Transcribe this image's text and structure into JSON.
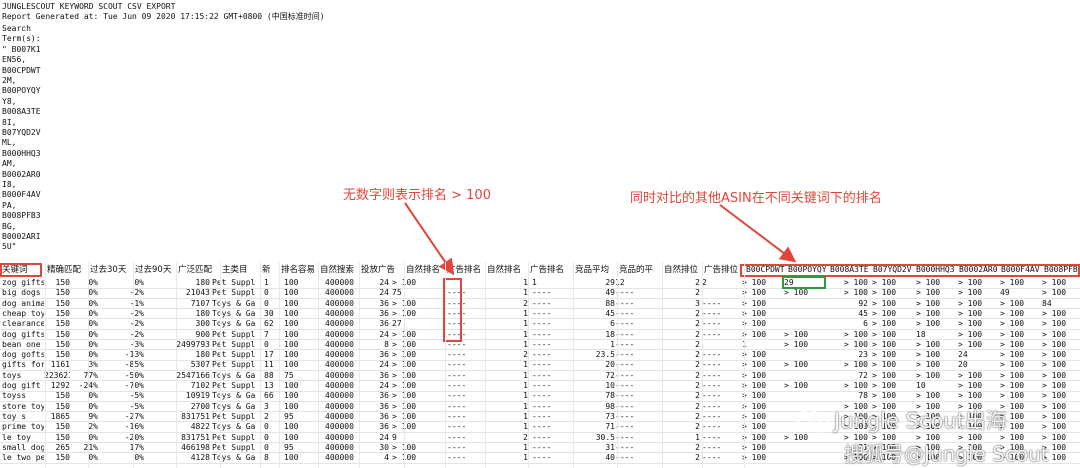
{
  "report": {
    "title": "JUNGLESCOUT KEYWORD SCOUT CSV EXPORT",
    "generated": "Report Generated at: Tue Jun 09 2020 17:15:22 GMT+0800 (中国标准时间)",
    "search_lines": [
      "Search",
      "Term(s):",
      "\" B007K1",
      "EN56,",
      "B00CPDWT",
      "2M,",
      "B00POYQY",
      "Y8,",
      "B008A3TE",
      "8I,",
      "B07YQD2V",
      "ML,",
      "B000HHQ3",
      "AM,",
      "B0002AR0",
      "I8,",
      "B000F4AV",
      "PA,",
      "B008PFB3",
      "BG,",
      "B0002ARI",
      "5U\""
    ]
  },
  "table": {
    "headers": [
      "关键词",
      "精确匹配",
      "过去30天",
      "过去90天",
      "广泛匹配",
      "主类目",
      "新",
      "排名容易",
      "自然搜索",
      "投放广告",
      "自然排名",
      "广告排名",
      "自然排名",
      "广告排名",
      "竞品平均",
      "竞品的平",
      "自然排位",
      "广告排位",
      "B00CPDWT",
      "B00POYQY",
      "B008A3TE",
      "B07YQD2V",
      "B000HHQ3",
      "B0002AR0",
      "B000F4AV",
      "B008PFB3"
    ],
    "rows": [
      [
        "zog gifts",
        "150",
        "0%",
        "0%",
        "180",
        "Pet Suppl",
        "1",
        "100",
        "400000",
        "24",
        "> 100",
        "",
        "",
        "1",
        "1",
        "29",
        "12",
        "2",
        "2",
        "> 100",
        "29",
        "> 100",
        "> 100",
        "> 100",
        "> 100",
        "> 100",
        "> 100"
      ],
      [
        "big dogs",
        "150",
        "0%",
        "-2%",
        "21043",
        "Pet Suppl",
        "0",
        "100",
        "400000",
        "24",
        "75",
        "----",
        "",
        "1",
        "----",
        "49",
        "----",
        "2",
        "",
        "> 100",
        "> 100",
        "> 100",
        "> 100",
        "> 100",
        "> 100",
        "49",
        "> 100"
      ],
      [
        "dog anima",
        "150",
        "0%",
        "-1%",
        "7107",
        "Toys & Ga",
        "0",
        "100",
        "400000",
        "36",
        "> 100",
        "----",
        "",
        "2",
        "----",
        "88",
        "----",
        "3",
        "----",
        "> 100",
        "",
        "92",
        "> 100",
        "> 100",
        "> 100",
        "> 100",
        "84"
      ],
      [
        "cheap toy",
        "150",
        "0%",
        "-2%",
        "180",
        "Toys & Ga",
        "30",
        "100",
        "400000",
        "36",
        "> 100",
        "----",
        "",
        "1",
        "----",
        "45",
        "----",
        "2",
        "----",
        "> 100",
        "",
        "45",
        "> 100",
        "> 100",
        "> 100",
        "> 100",
        "> 100"
      ],
      [
        "clearance",
        "150",
        "0%",
        "-2%",
        "300",
        "Toys & Ga",
        "62",
        "100",
        "400000",
        "36",
        "27",
        "----",
        "",
        "1",
        "----",
        "6",
        "----",
        "2",
        "----",
        "> 100",
        "",
        "6",
        "> 100",
        "> 100",
        "> 100",
        "> 100",
        "> 100"
      ],
      [
        "dog gifts",
        "150",
        "0%",
        "-2%",
        "900",
        "Pet Suppl",
        "7",
        "100",
        "400000",
        "24",
        "> 100",
        "----",
        "",
        "1",
        "----",
        "18",
        "----",
        "2",
        "----",
        "> 100",
        "> 100",
        "> 100",
        "> 100",
        "18",
        "> 100",
        "> 100",
        "> 100"
      ],
      [
        "bean one",
        "150",
        "0%",
        "-3%",
        "2499793",
        "Pet Suppl",
        "0",
        "100",
        "400000",
        "8",
        "> 100",
        "----",
        "",
        "1",
        "----",
        "1",
        "----",
        "2",
        "",
        "1",
        "> 100",
        "> 100",
        "> 100",
        "> 100",
        "> 100",
        "> 100",
        "> 100"
      ],
      [
        "dog gofts",
        "150",
        "0%",
        "-13%",
        "180",
        "Pet Suppl",
        "17",
        "100",
        "400000",
        "36",
        "> 100",
        "----",
        "",
        "2",
        "----",
        "23.5",
        "----",
        "2",
        "----",
        "> 100",
        "",
        "23",
        "> 100",
        "> 100",
        "24",
        "> 100",
        "> 100"
      ],
      [
        "gifts for",
        "1161",
        "3%",
        "-85%",
        "5307",
        "Pet Suppl",
        "11",
        "100",
        "400000",
        "24",
        "> 100",
        "----",
        "",
        "1",
        "----",
        "20",
        "----",
        "2",
        "----",
        "> 100",
        "> 100",
        "> 100",
        "> 100",
        "> 100",
        "20",
        "> 100",
        "> 100"
      ],
      [
        "toys",
        "223621",
        "77%",
        "-50%",
        "2547166",
        "Toys & Ga",
        "88",
        "75",
        "400000",
        "36",
        "> 100",
        "----",
        "",
        "1",
        "----",
        "72",
        "----",
        "2",
        "----",
        "> 100",
        "",
        "72",
        "> 100",
        "> 100",
        "> 100",
        "> 100",
        "> 100"
      ],
      [
        "dog gift",
        "1292",
        "-24%",
        "-70%",
        "7102",
        "Pet Suppl",
        "13",
        "100",
        "400000",
        "24",
        "> 100",
        "----",
        "",
        "1",
        "----",
        "10",
        "----",
        "2",
        "----",
        "> 100",
        "> 100",
        "> 100",
        "> 100",
        "10",
        "> 100",
        "> 100",
        "> 100"
      ],
      [
        "toyss",
        "150",
        "0%",
        "-5%",
        "10919",
        "Toys & Ga",
        "66",
        "100",
        "400000",
        "36",
        "> 100",
        "----",
        "",
        "1",
        "----",
        "78",
        "----",
        "2",
        "----",
        "> 100",
        "",
        "78",
        "> 100",
        "> 100",
        "> 100",
        "> 100",
        "> 100"
      ],
      [
        "store toy",
        "150",
        "0%",
        "-5%",
        "2700",
        "Toys & Ga",
        "3",
        "100",
        "400000",
        "36",
        "> 100",
        "----",
        "",
        "1",
        "----",
        "98",
        "----",
        "2",
        "----",
        "> 100",
        "",
        "> 100",
        "> 100",
        "> 100",
        "> 100",
        "> 100",
        "> 100"
      ],
      [
        "toy s",
        "1865",
        "9%",
        "-27%",
        "831751",
        "Pet Suppl",
        "2",
        "95",
        "400000",
        "36",
        "> 100",
        "----",
        "",
        "1",
        "----",
        "73",
        "----",
        "2",
        "----",
        "> 100",
        "",
        "> 100",
        "> 100",
        "> 100",
        "> 100",
        "> 100",
        "> 100"
      ],
      [
        "prime toy",
        "150",
        "2%",
        "-16%",
        "4822",
        "Toys & Ga",
        "0",
        "100",
        "400000",
        "36",
        "> 100",
        "----",
        "",
        "1",
        "----",
        "71",
        "----",
        "2",
        "----",
        "> 100",
        "",
        "> 100",
        "> 100",
        "> 100",
        "> 100",
        "> 100",
        "> 100"
      ],
      [
        "le toy",
        "150",
        "0%",
        "-20%",
        "831751",
        "Pet Suppl",
        "0",
        "100",
        "400000",
        "24",
        "9",
        "----",
        "",
        "2",
        "----",
        "30.5",
        "----",
        "1",
        "----",
        "> 100",
        "> 100",
        "> 100",
        "> 100",
        "> 100",
        "> 100",
        "> 100",
        "> 100"
      ],
      [
        "small dog",
        "265",
        "21%",
        "17%",
        "466198",
        "Pet Suppl",
        "0",
        "95",
        "400000",
        "30",
        "> 100",
        "----",
        "",
        "1",
        "----",
        "31",
        "----",
        "2",
        "----",
        "> 100",
        "",
        "31",
        "> 100",
        "> 100",
        "> 100",
        "> 100",
        "> 100"
      ],
      [
        "le two pe",
        "150",
        "0%",
        "0%",
        "4128",
        "Toys & Ga",
        "8",
        "100",
        "400000",
        "4",
        "> 100",
        "----",
        "",
        "1",
        "----",
        "40",
        "----",
        "2",
        "----",
        "> 100",
        "",
        "> 100",
        "> 100",
        "> 100",
        "> 100",
        "> 100",
        "> 100"
      ]
    ]
  },
  "annotations": {
    "left": "无数字则表示排名 > 100",
    "right": "同时对比的其他ASIN在不同关键词下的排名"
  },
  "watermark": {
    "en": "Jungle Scout出海",
    "cn": "搜狐号@Jungle Scout"
  },
  "colors": {
    "annotation": "#e0463c",
    "selection": "#2f9a41",
    "grid": "#e4e4e4"
  }
}
